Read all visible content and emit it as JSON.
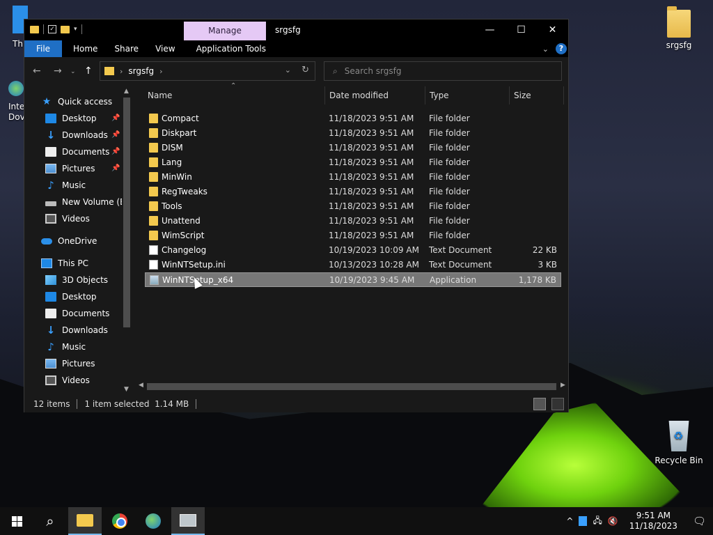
{
  "window": {
    "title": "srgsfg",
    "manage_tab": "Manage",
    "ribbon_tabs": [
      "File",
      "Home",
      "Share",
      "View",
      "Application Tools"
    ],
    "help_label": "?"
  },
  "address": {
    "crumb": "srgsfg",
    "search_placeholder": "Search srgsfg"
  },
  "nav_pane": {
    "items": [
      {
        "label": "Quick access",
        "icon": "star-icon"
      },
      {
        "label": "Desktop",
        "icon": "desktop-icon",
        "pinned": true
      },
      {
        "label": "Downloads",
        "icon": "download-icon",
        "pinned": true
      },
      {
        "label": "Documents",
        "icon": "documents-icon",
        "pinned": true
      },
      {
        "label": "Pictures",
        "icon": "pictures-icon",
        "pinned": true
      },
      {
        "label": "Music",
        "icon": "music-icon"
      },
      {
        "label": "New Volume (E:)",
        "icon": "drive-icon"
      },
      {
        "label": "Videos",
        "icon": "videos-icon"
      },
      {
        "label": "OneDrive",
        "icon": "cloud-icon"
      },
      {
        "label": "This PC",
        "icon": "computer-icon"
      },
      {
        "label": "3D Objects",
        "icon": "cube-icon"
      },
      {
        "label": "Desktop",
        "icon": "desktop-icon"
      },
      {
        "label": "Documents",
        "icon": "documents-icon"
      },
      {
        "label": "Downloads",
        "icon": "download-icon"
      },
      {
        "label": "Music",
        "icon": "music-icon"
      },
      {
        "label": "Pictures",
        "icon": "pictures-icon"
      },
      {
        "label": "Videos",
        "icon": "videos-icon"
      }
    ]
  },
  "columns": {
    "name": "Name",
    "date": "Date modified",
    "type": "Type",
    "size": "Size"
  },
  "files": [
    {
      "name": "Compact",
      "date": "11/18/2023 9:51 AM",
      "type": "File folder",
      "size": "",
      "kind": "folder"
    },
    {
      "name": "Diskpart",
      "date": "11/18/2023 9:51 AM",
      "type": "File folder",
      "size": "",
      "kind": "folder"
    },
    {
      "name": "DISM",
      "date": "11/18/2023 9:51 AM",
      "type": "File folder",
      "size": "",
      "kind": "folder"
    },
    {
      "name": "Lang",
      "date": "11/18/2023 9:51 AM",
      "type": "File folder",
      "size": "",
      "kind": "folder"
    },
    {
      "name": "MinWin",
      "date": "11/18/2023 9:51 AM",
      "type": "File folder",
      "size": "",
      "kind": "folder"
    },
    {
      "name": "RegTweaks",
      "date": "11/18/2023 9:51 AM",
      "type": "File folder",
      "size": "",
      "kind": "folder"
    },
    {
      "name": "Tools",
      "date": "11/18/2023 9:51 AM",
      "type": "File folder",
      "size": "",
      "kind": "folder"
    },
    {
      "name": "Unattend",
      "date": "11/18/2023 9:51 AM",
      "type": "File folder",
      "size": "",
      "kind": "folder"
    },
    {
      "name": "WimScript",
      "date": "11/18/2023 9:51 AM",
      "type": "File folder",
      "size": "",
      "kind": "folder"
    },
    {
      "name": "Changelog",
      "date": "10/19/2023 10:09 AM",
      "type": "Text Document",
      "size": "22 KB",
      "kind": "text"
    },
    {
      "name": "WinNTSetup.ini",
      "date": "10/13/2023 10:28 AM",
      "type": "Text Document",
      "size": "3 KB",
      "kind": "text"
    },
    {
      "name": "WinNTSetup_x64",
      "date": "10/19/2023 9:45 AM",
      "type": "Application",
      "size": "1,178 KB",
      "kind": "app",
      "selected": true
    }
  ],
  "status": {
    "count": "12 items",
    "selection": "1 item selected  1.14 MB"
  },
  "desktop": {
    "folder_label": "srgsfg",
    "recycle_label": "Recycle Bin",
    "left_partial_1": "Th",
    "left_partial_2": "Inte",
    "left_partial_3": "Dov"
  },
  "taskbar": {
    "time": "9:51 AM",
    "date": "11/18/2023"
  }
}
